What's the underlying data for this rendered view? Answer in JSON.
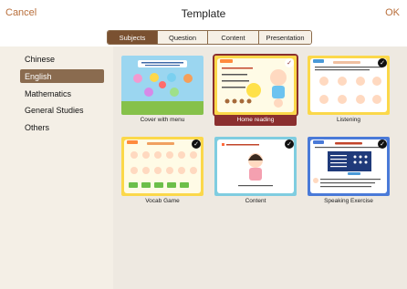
{
  "header": {
    "cancel_label": "Cancel",
    "title": "Template",
    "ok_label": "OK"
  },
  "tabs": [
    {
      "label": "Subjects",
      "active": true
    },
    {
      "label": "Question",
      "active": false
    },
    {
      "label": "Content",
      "active": false
    },
    {
      "label": "Presentation",
      "active": false
    }
  ],
  "sidebar": {
    "items": [
      {
        "label": "Chinese",
        "active": false
      },
      {
        "label": "English",
        "active": true
      },
      {
        "label": "Mathematics",
        "active": false
      },
      {
        "label": "General Studies",
        "active": false
      },
      {
        "label": "Others",
        "active": false
      }
    ]
  },
  "templates": [
    {
      "caption": "Cover with menu",
      "selected": false
    },
    {
      "caption": "Home reading",
      "selected": true
    },
    {
      "caption": "Listening",
      "selected": false
    },
    {
      "caption": "Vocab Game",
      "selected": false
    },
    {
      "caption": "Content",
      "selected": false
    },
    {
      "caption": "Speaking Exercise",
      "selected": false
    }
  ],
  "colors": {
    "accent": "#b86e3a",
    "selected_caption_bg": "#8a2f2f",
    "active_tab": "#7a5131",
    "active_sidebar": "#8a6b4f"
  }
}
